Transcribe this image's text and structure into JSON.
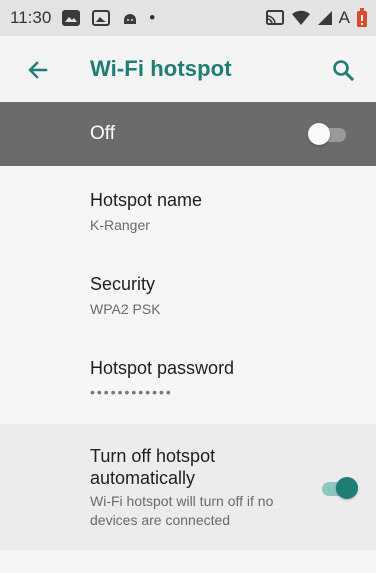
{
  "status_bar": {
    "time": "11:30",
    "carrier_letter": "A",
    "dot": "•",
    "icons": [
      "photo-icon",
      "image-icon",
      "android-icon",
      "dot-icon",
      "cast-icon",
      "wifi-icon",
      "signal-icon",
      "battery-icon"
    ],
    "battery_color": "#d94b2b"
  },
  "app_bar": {
    "title": "Wi-Fi hotspot",
    "back_icon": "arrow-back-icon",
    "search_icon": "search-icon",
    "accent_color": "#1e7d74"
  },
  "master_switch": {
    "label": "Off",
    "checked": false
  },
  "settings": {
    "items": [
      {
        "title": "Hotspot name",
        "summary": "K-Ranger"
      },
      {
        "title": "Security",
        "summary": "WPA2 PSK"
      },
      {
        "title": "Hotspot password",
        "summary": "••••••••••••"
      }
    ],
    "auto_off": {
      "title": "Turn off hotspot automatically",
      "summary": "Wi-Fi hotspot will turn off if no devices are connected",
      "checked": true
    }
  }
}
